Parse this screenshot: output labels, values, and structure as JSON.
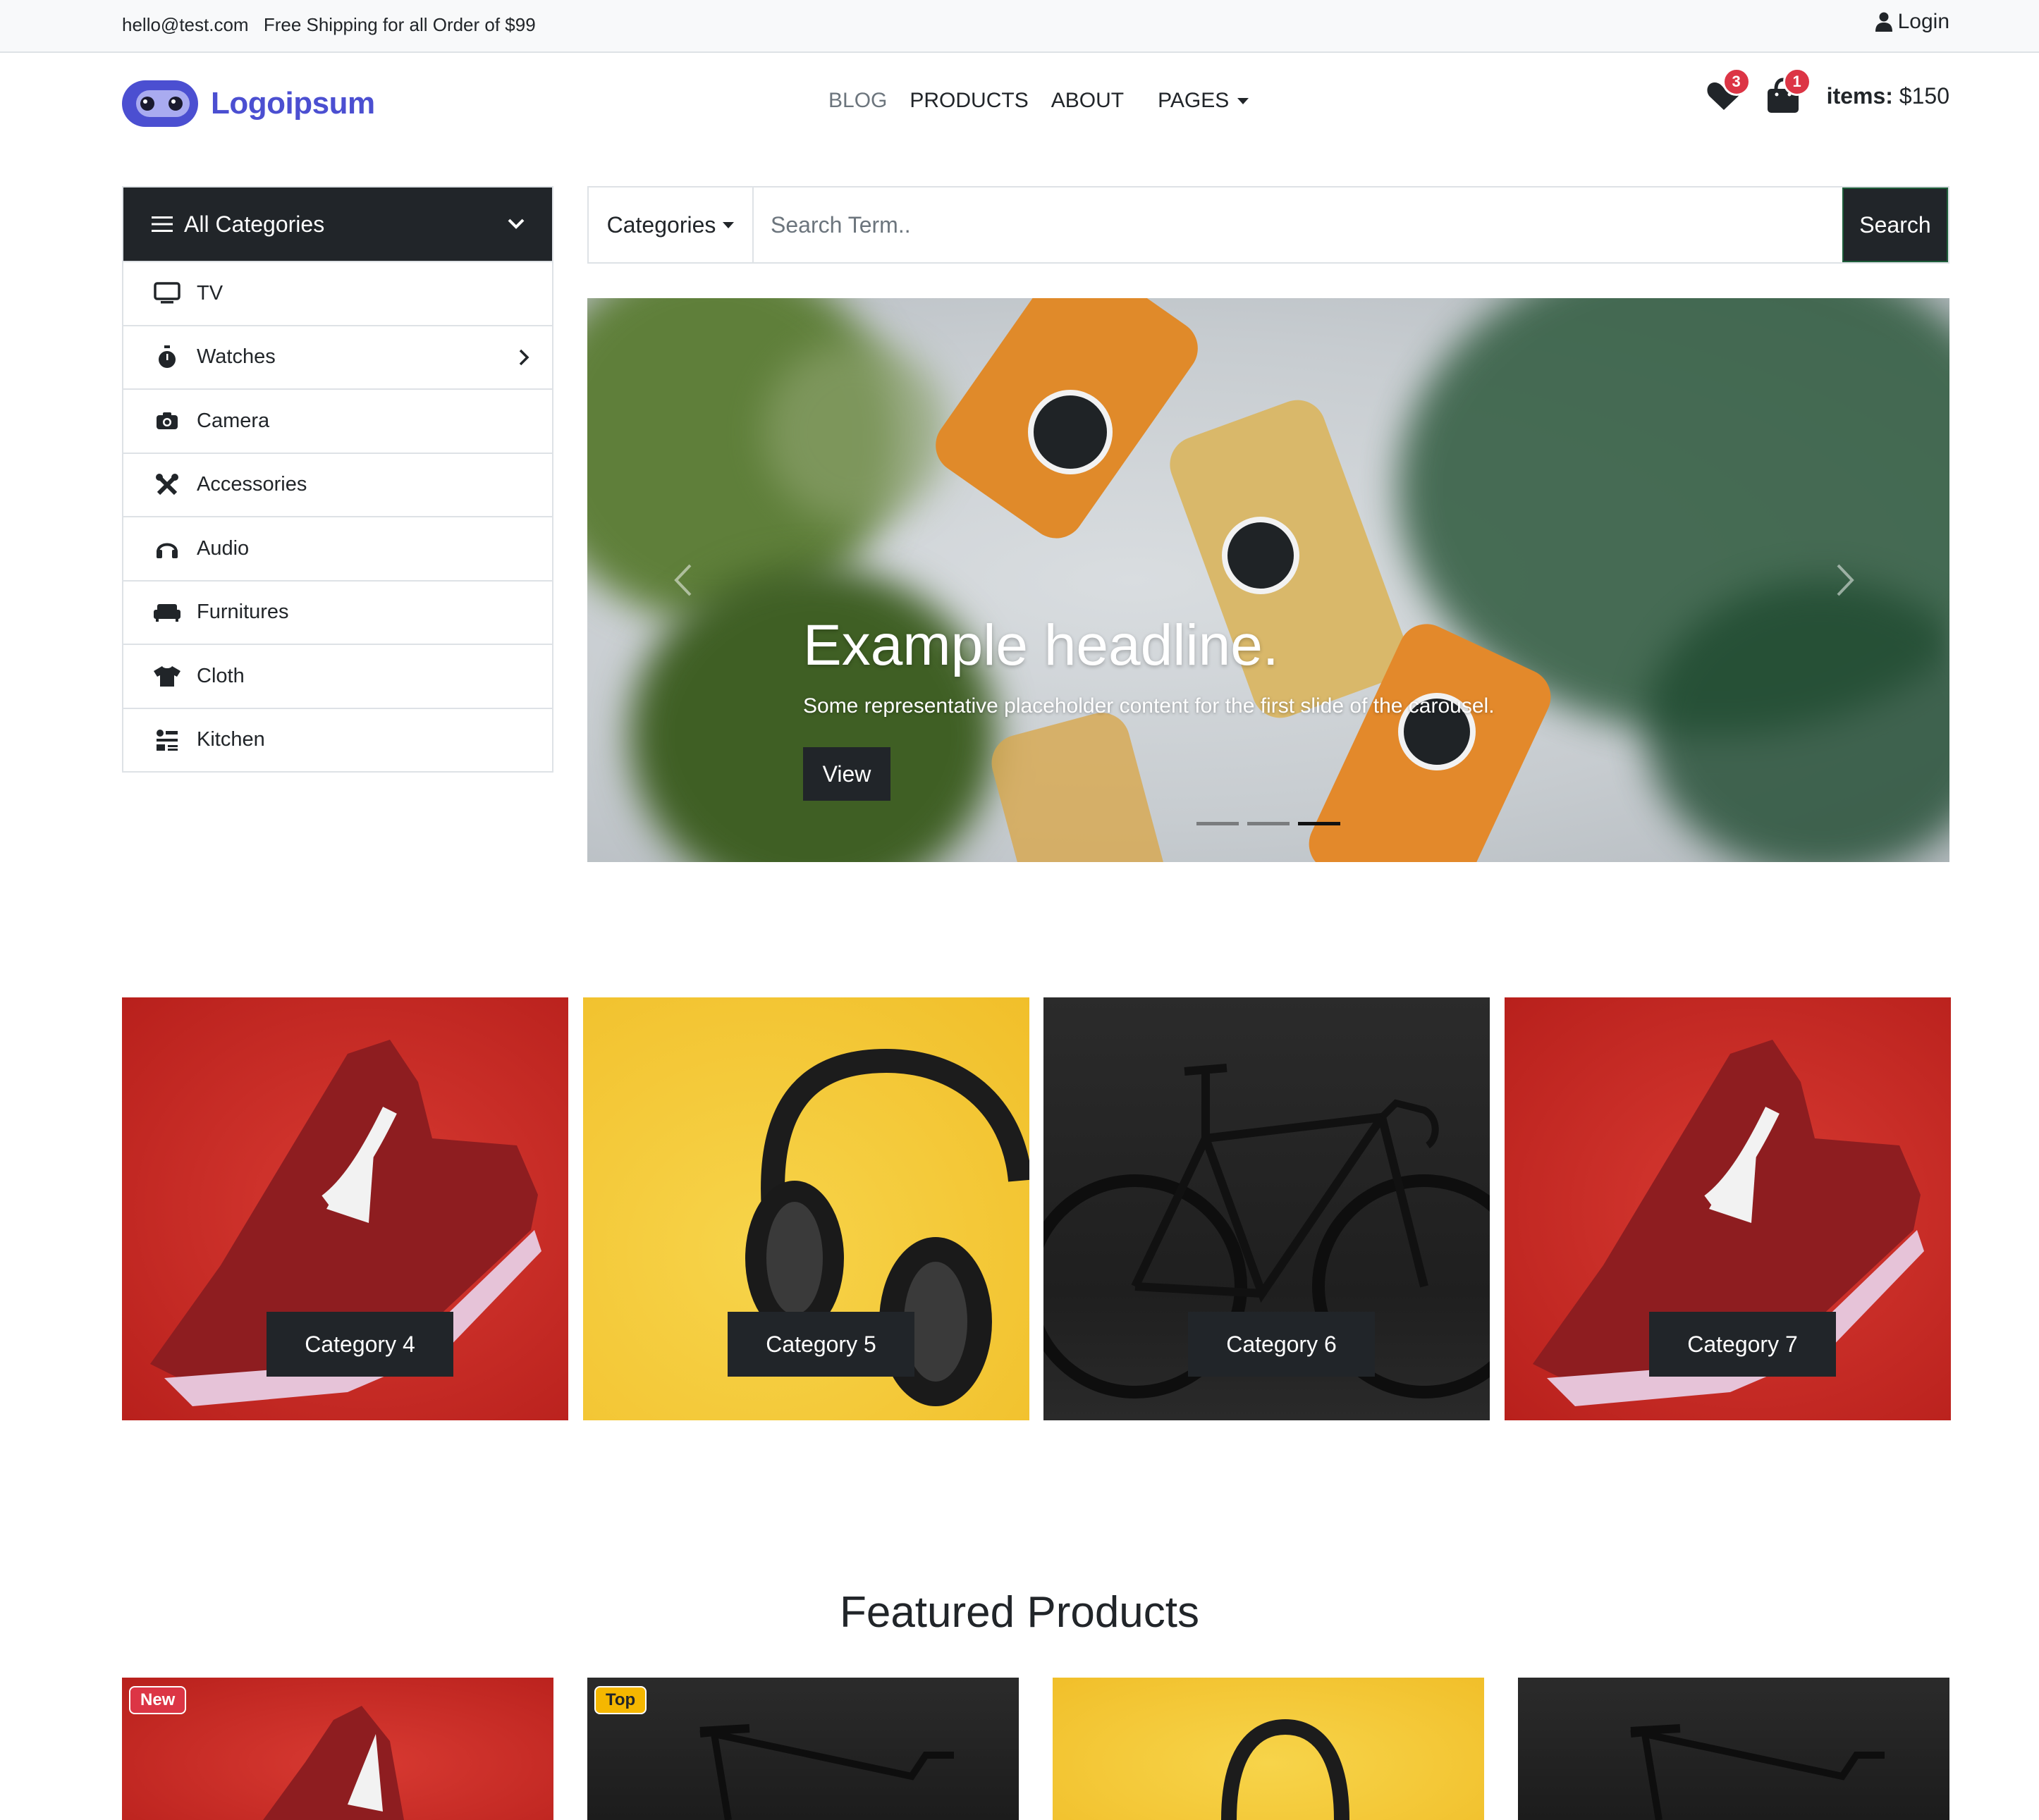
{
  "topbar": {
    "email": "hello@test.com",
    "shipping": "Free Shipping for all Order of $99",
    "login": "Login"
  },
  "header": {
    "logo_text": "Logoipsum",
    "nav": [
      "BLOG",
      "PRODUCTS",
      "ABOUT"
    ],
    "pages_label": "PAGES",
    "wishlist_count": "3",
    "cart_count": "1",
    "items_label": "items:",
    "items_total": "$150"
  },
  "sidebar": {
    "title": "All Categories",
    "items": [
      {
        "label": "TV",
        "icon": "tv-icon"
      },
      {
        "label": "Watches",
        "icon": "stopwatch-icon"
      },
      {
        "label": "Camera",
        "icon": "camera-icon"
      },
      {
        "label": "Accessories",
        "icon": "tools-icon"
      },
      {
        "label": "Audio",
        "icon": "headphones-icon"
      },
      {
        "label": "Furnitures",
        "icon": "couch-icon"
      },
      {
        "label": "Cloth",
        "icon": "tshirt-icon"
      },
      {
        "label": "Kitchen",
        "icon": "kitchen-icon"
      }
    ]
  },
  "search": {
    "categories_label": "Categories",
    "placeholder": "Search Term..",
    "button": "Search"
  },
  "hero": {
    "headline": "Example headline.",
    "subtext": "Some representative placeholder content for the first slide of the carousel.",
    "button": "View"
  },
  "categories": [
    "Category 4",
    "Category 5",
    "Category 6",
    "Category 7"
  ],
  "featured": {
    "title": "Featured Products",
    "badges": [
      "New",
      "Top"
    ]
  },
  "colors": {
    "brand": "#4b4fd1",
    "dark": "#212529",
    "badge_red": "#dc3545",
    "badge_yellow": "#f5b700"
  }
}
